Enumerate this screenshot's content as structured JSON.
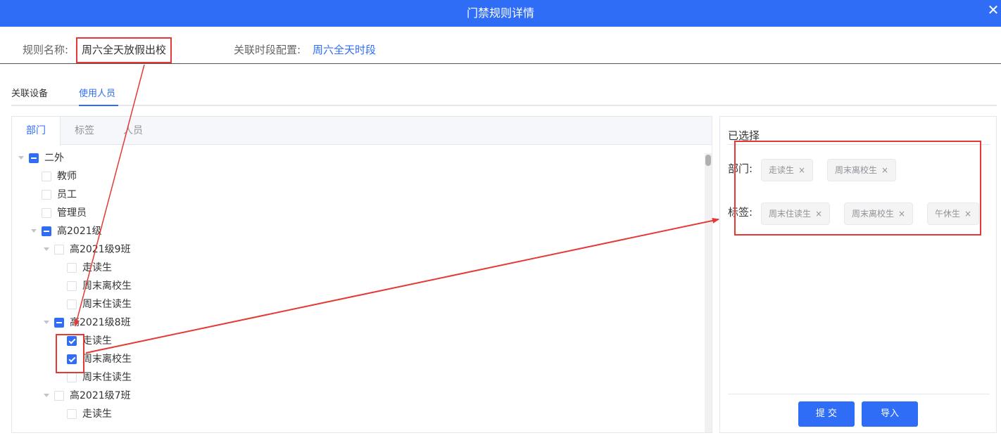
{
  "dialog": {
    "title": "门禁规则详情",
    "close_glyph": "✕"
  },
  "info": {
    "rule_name_label": "规则名称:",
    "rule_name_value": "周六全天放假出校",
    "time_config_label": "关联时段配置:",
    "time_config_value": "周六全天时段"
  },
  "top_tabs": [
    {
      "label": "关联设备",
      "active": false
    },
    {
      "label": "使用人员",
      "active": true
    }
  ],
  "sub_tabs": [
    {
      "label": "部门",
      "active": true
    },
    {
      "label": "标签",
      "active": false
    },
    {
      "label": "人员",
      "active": false
    }
  ],
  "tree": [
    {
      "label": "二外",
      "level": 0,
      "has_arrow": true,
      "state": "indeterminate"
    },
    {
      "label": "教师",
      "level": 1,
      "has_arrow": false,
      "state": "unchecked"
    },
    {
      "label": "员工",
      "level": 1,
      "has_arrow": false,
      "state": "unchecked"
    },
    {
      "label": "管理员",
      "level": 1,
      "has_arrow": false,
      "state": "unchecked"
    },
    {
      "label": "高2021级",
      "level": 1,
      "has_arrow": true,
      "state": "indeterminate"
    },
    {
      "label": "高2021级9班",
      "level": 2,
      "has_arrow": true,
      "state": "unchecked"
    },
    {
      "label": "走读生",
      "level": 3,
      "has_arrow": false,
      "state": "unchecked"
    },
    {
      "label": "周末离校生",
      "level": 3,
      "has_arrow": false,
      "state": "unchecked"
    },
    {
      "label": "周末住读生",
      "level": 3,
      "has_arrow": false,
      "state": "unchecked"
    },
    {
      "label": "高2021级8班",
      "level": 2,
      "has_arrow": true,
      "state": "indeterminate"
    },
    {
      "label": "走读生",
      "level": 3,
      "has_arrow": false,
      "state": "checked"
    },
    {
      "label": "周末离校生",
      "level": 3,
      "has_arrow": false,
      "state": "checked"
    },
    {
      "label": "周末住读生",
      "level": 3,
      "has_arrow": false,
      "state": "unchecked"
    },
    {
      "label": "高2021级7班",
      "level": 2,
      "has_arrow": true,
      "state": "unchecked"
    },
    {
      "label": "走读生",
      "level": 3,
      "has_arrow": false,
      "state": "unchecked"
    }
  ],
  "selected": {
    "title": "已选择",
    "department_label": "部门:",
    "departments": [
      "走读生",
      "周末离校生"
    ],
    "tag_label": "标签:",
    "tags": [
      "周末住读生",
      "周末离校生",
      "午休生"
    ],
    "tag_close_glyph": "×"
  },
  "buttons": {
    "submit": "提 交",
    "import": "导入"
  },
  "colors": {
    "primary": "#2f6df6",
    "annotation": "#e53935"
  }
}
